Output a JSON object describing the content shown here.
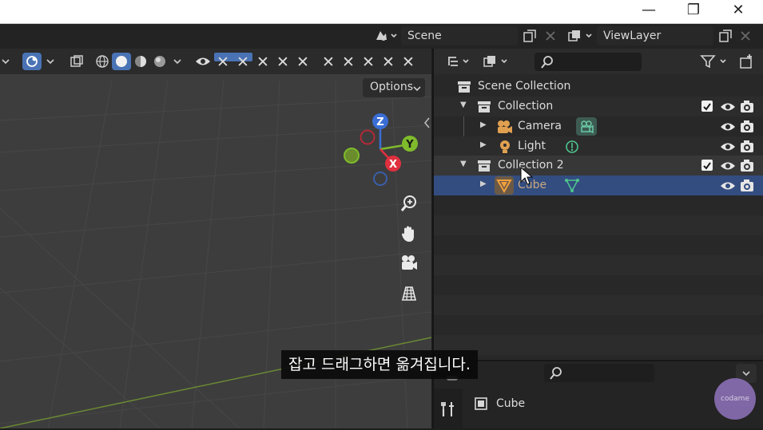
{
  "window": {
    "minimize_glyph": "—",
    "maximize_glyph": "❐",
    "close_glyph": "✕"
  },
  "topbar": {
    "scene_name": "Scene",
    "view_layer_name": "ViewLayer"
  },
  "viewport": {
    "options_label": "Options",
    "gizmo_axes": [
      "Z",
      "Y",
      "X"
    ],
    "axis_colors": {
      "x": "#e0303f",
      "y": "#7fbb2c",
      "z": "#3a6ed6"
    }
  },
  "outliner": {
    "rows": [
      {
        "label": "Scene Collection"
      },
      {
        "label": "Collection"
      },
      {
        "label": "Camera"
      },
      {
        "label": "Light"
      },
      {
        "label": "Collection 2"
      },
      {
        "label": "Cube"
      }
    ],
    "accent_selected": "#334d80"
  },
  "properties": {
    "object_name": "Cube"
  },
  "subtitle": "잡고 드래그하면 옮겨집니다.",
  "watermark": "codame"
}
